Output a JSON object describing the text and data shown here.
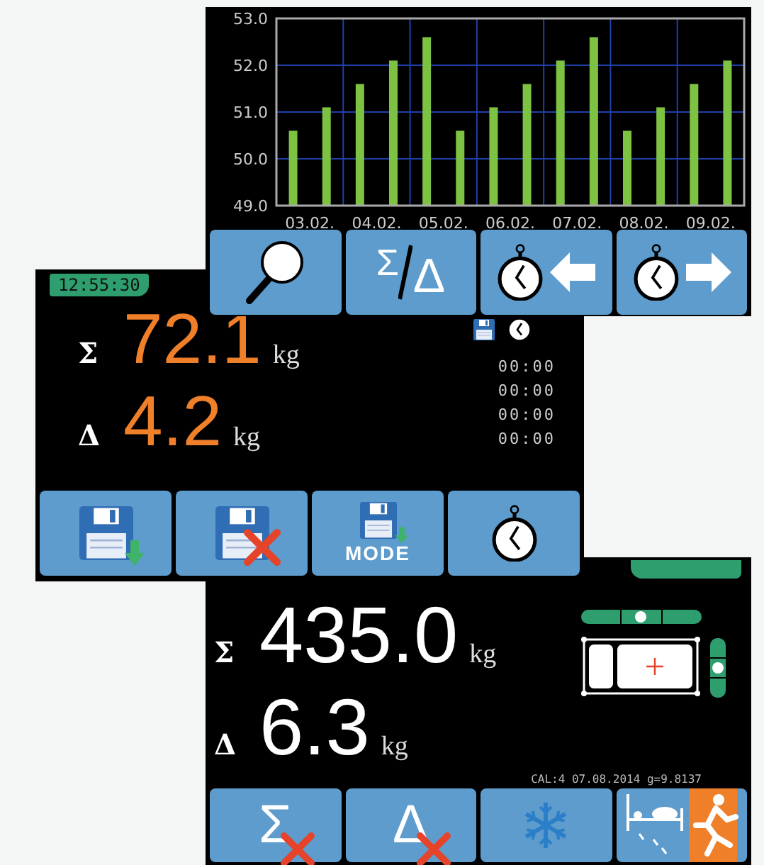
{
  "chart_screen": {
    "chart_data": {
      "type": "bar",
      "grid": true,
      "categories": [
        "03.02.",
        "04.02.",
        "05.02.",
        "06.02.",
        "07.02.",
        "08.02.",
        "09.02."
      ],
      "series": [
        {
          "color": "#7dc242",
          "values": [
            50.6,
            51.6,
            52.6,
            51.1,
            52.1,
            50.6,
            51.6
          ]
        },
        {
          "color": "#7dc242",
          "values": [
            51.1,
            52.1,
            50.6,
            51.6,
            52.6,
            51.1,
            52.1
          ]
        }
      ],
      "ylim": [
        49,
        53
      ],
      "yticks": [
        {
          "value": 49,
          "label": "49.0"
        },
        {
          "value": 50,
          "label": "50.0"
        },
        {
          "value": 51,
          "label": "51.0"
        },
        {
          "value": 52,
          "label": "52.0"
        },
        {
          "value": 53,
          "label": "53.0"
        }
      ]
    },
    "buttons": [
      {
        "kind": "zoom"
      },
      {
        "kind": "sum_delta",
        "symbols": [
          "Σ",
          "Δ"
        ]
      },
      {
        "kind": "time_back"
      },
      {
        "kind": "time_forward"
      }
    ]
  },
  "weighing_screen": {
    "clock": "12:55:30",
    "rows": [
      {
        "symbol": "Σ",
        "value": "72.1",
        "unit": "kg"
      },
      {
        "symbol": "Δ",
        "value": "4.2",
        "unit": "kg"
      }
    ],
    "saved_times": [
      "00:00",
      "00:00",
      "00:00",
      "00:00"
    ],
    "buttons": [
      {
        "kind": "save"
      },
      {
        "kind": "delete_save"
      },
      {
        "kind": "save_mode",
        "label": "MODE"
      },
      {
        "kind": "timer"
      }
    ]
  },
  "patient_screen": {
    "rows": [
      {
        "symbol": "Σ",
        "value": "435.0",
        "unit": "kg"
      },
      {
        "symbol": "Δ",
        "value": "6.3",
        "unit": "kg"
      }
    ],
    "calibration": "CAL:4 07.08.2014 g=9.8137",
    "buttons": [
      {
        "kind": "clear",
        "symbol": "Σ"
      },
      {
        "kind": "clear",
        "symbol": "Δ"
      },
      {
        "kind": "freeze"
      },
      {
        "kind": "exit"
      }
    ]
  }
}
